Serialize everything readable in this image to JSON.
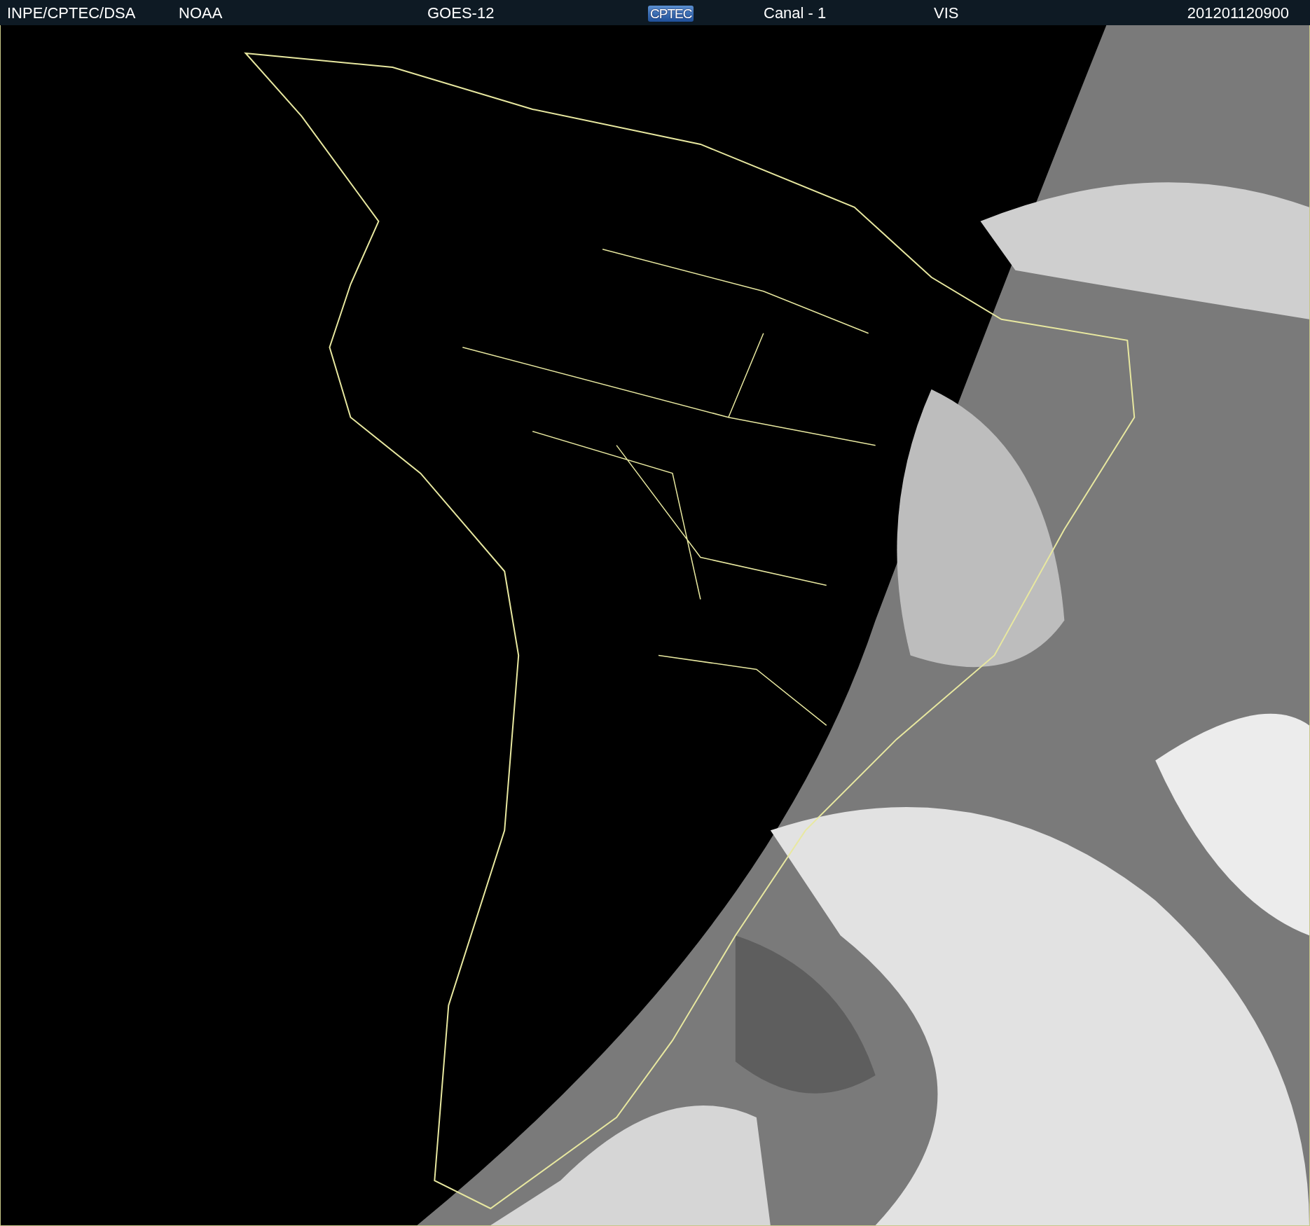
{
  "header": {
    "source": "INPE/CPTEC/DSA",
    "agency": "NOAA",
    "satellite": "GOES-12",
    "logo": "CPTEC",
    "channel": "Canal - 1",
    "band": "VIS",
    "timestamp": "201201120900"
  }
}
